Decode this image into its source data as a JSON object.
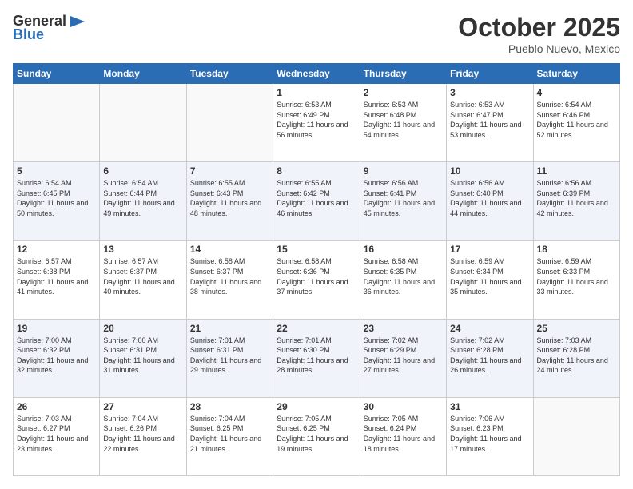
{
  "logo": {
    "text_general": "General",
    "text_blue": "Blue"
  },
  "title": "October 2025",
  "subtitle": "Pueblo Nuevo, Mexico",
  "days_of_week": [
    "Sunday",
    "Monday",
    "Tuesday",
    "Wednesday",
    "Thursday",
    "Friday",
    "Saturday"
  ],
  "weeks": [
    [
      {
        "day": "",
        "info": ""
      },
      {
        "day": "",
        "info": ""
      },
      {
        "day": "",
        "info": ""
      },
      {
        "day": "1",
        "info": "Sunrise: 6:53 AM\nSunset: 6:49 PM\nDaylight: 11 hours and 56 minutes."
      },
      {
        "day": "2",
        "info": "Sunrise: 6:53 AM\nSunset: 6:48 PM\nDaylight: 11 hours and 54 minutes."
      },
      {
        "day": "3",
        "info": "Sunrise: 6:53 AM\nSunset: 6:47 PM\nDaylight: 11 hours and 53 minutes."
      },
      {
        "day": "4",
        "info": "Sunrise: 6:54 AM\nSunset: 6:46 PM\nDaylight: 11 hours and 52 minutes."
      }
    ],
    [
      {
        "day": "5",
        "info": "Sunrise: 6:54 AM\nSunset: 6:45 PM\nDaylight: 11 hours and 50 minutes."
      },
      {
        "day": "6",
        "info": "Sunrise: 6:54 AM\nSunset: 6:44 PM\nDaylight: 11 hours and 49 minutes."
      },
      {
        "day": "7",
        "info": "Sunrise: 6:55 AM\nSunset: 6:43 PM\nDaylight: 11 hours and 48 minutes."
      },
      {
        "day": "8",
        "info": "Sunrise: 6:55 AM\nSunset: 6:42 PM\nDaylight: 11 hours and 46 minutes."
      },
      {
        "day": "9",
        "info": "Sunrise: 6:56 AM\nSunset: 6:41 PM\nDaylight: 11 hours and 45 minutes."
      },
      {
        "day": "10",
        "info": "Sunrise: 6:56 AM\nSunset: 6:40 PM\nDaylight: 11 hours and 44 minutes."
      },
      {
        "day": "11",
        "info": "Sunrise: 6:56 AM\nSunset: 6:39 PM\nDaylight: 11 hours and 42 minutes."
      }
    ],
    [
      {
        "day": "12",
        "info": "Sunrise: 6:57 AM\nSunset: 6:38 PM\nDaylight: 11 hours and 41 minutes."
      },
      {
        "day": "13",
        "info": "Sunrise: 6:57 AM\nSunset: 6:37 PM\nDaylight: 11 hours and 40 minutes."
      },
      {
        "day": "14",
        "info": "Sunrise: 6:58 AM\nSunset: 6:37 PM\nDaylight: 11 hours and 38 minutes."
      },
      {
        "day": "15",
        "info": "Sunrise: 6:58 AM\nSunset: 6:36 PM\nDaylight: 11 hours and 37 minutes."
      },
      {
        "day": "16",
        "info": "Sunrise: 6:58 AM\nSunset: 6:35 PM\nDaylight: 11 hours and 36 minutes."
      },
      {
        "day": "17",
        "info": "Sunrise: 6:59 AM\nSunset: 6:34 PM\nDaylight: 11 hours and 35 minutes."
      },
      {
        "day": "18",
        "info": "Sunrise: 6:59 AM\nSunset: 6:33 PM\nDaylight: 11 hours and 33 minutes."
      }
    ],
    [
      {
        "day": "19",
        "info": "Sunrise: 7:00 AM\nSunset: 6:32 PM\nDaylight: 11 hours and 32 minutes."
      },
      {
        "day": "20",
        "info": "Sunrise: 7:00 AM\nSunset: 6:31 PM\nDaylight: 11 hours and 31 minutes."
      },
      {
        "day": "21",
        "info": "Sunrise: 7:01 AM\nSunset: 6:31 PM\nDaylight: 11 hours and 29 minutes."
      },
      {
        "day": "22",
        "info": "Sunrise: 7:01 AM\nSunset: 6:30 PM\nDaylight: 11 hours and 28 minutes."
      },
      {
        "day": "23",
        "info": "Sunrise: 7:02 AM\nSunset: 6:29 PM\nDaylight: 11 hours and 27 minutes."
      },
      {
        "day": "24",
        "info": "Sunrise: 7:02 AM\nSunset: 6:28 PM\nDaylight: 11 hours and 26 minutes."
      },
      {
        "day": "25",
        "info": "Sunrise: 7:03 AM\nSunset: 6:28 PM\nDaylight: 11 hours and 24 minutes."
      }
    ],
    [
      {
        "day": "26",
        "info": "Sunrise: 7:03 AM\nSunset: 6:27 PM\nDaylight: 11 hours and 23 minutes."
      },
      {
        "day": "27",
        "info": "Sunrise: 7:04 AM\nSunset: 6:26 PM\nDaylight: 11 hours and 22 minutes."
      },
      {
        "day": "28",
        "info": "Sunrise: 7:04 AM\nSunset: 6:25 PM\nDaylight: 11 hours and 21 minutes."
      },
      {
        "day": "29",
        "info": "Sunrise: 7:05 AM\nSunset: 6:25 PM\nDaylight: 11 hours and 19 minutes."
      },
      {
        "day": "30",
        "info": "Sunrise: 7:05 AM\nSunset: 6:24 PM\nDaylight: 11 hours and 18 minutes."
      },
      {
        "day": "31",
        "info": "Sunrise: 7:06 AM\nSunset: 6:23 PM\nDaylight: 11 hours and 17 minutes."
      },
      {
        "day": "",
        "info": ""
      }
    ]
  ]
}
